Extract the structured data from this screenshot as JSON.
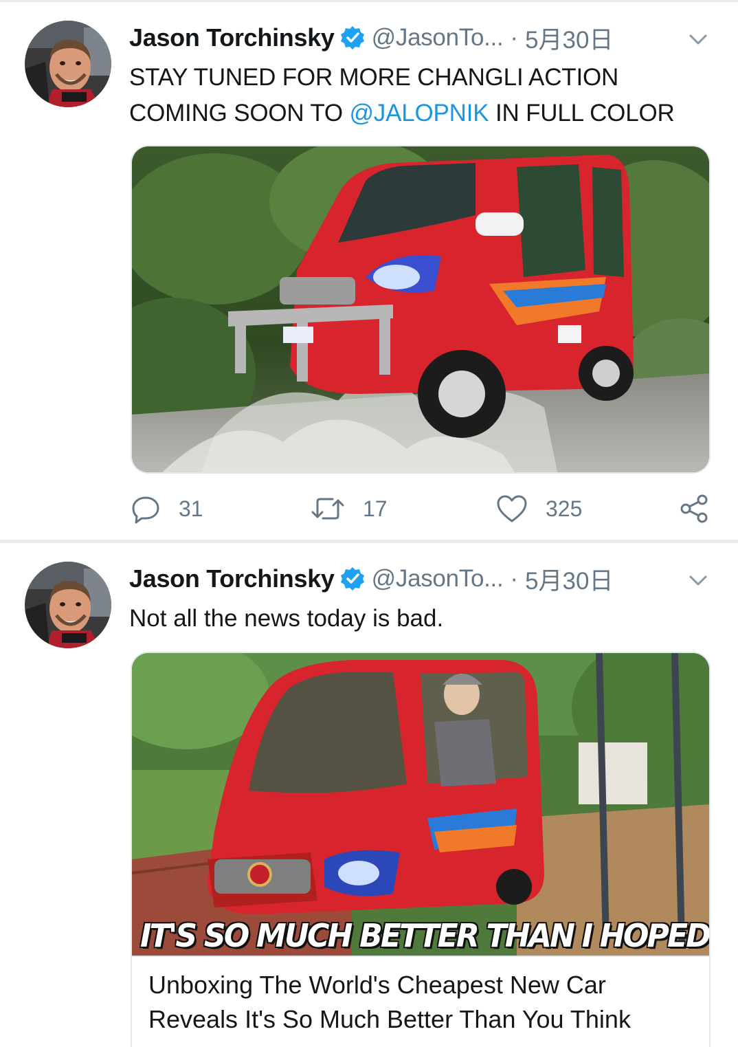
{
  "tweets": [
    {
      "author": {
        "display_name": "Jason Torchinsky",
        "handle": "@JasonTo...",
        "verified": true
      },
      "separator": "·",
      "date": "5月30日",
      "text_line1": "STAY TUNED FOR MORE CHANGLI ACTION",
      "text_line2_prefix": "COMING SOON TO ",
      "text_line2_mention": "@JALOPNIK",
      "text_line2_suffix": " IN FULL COLOR",
      "media": {
        "description_icon": "red-changli-car-splashing-through-water"
      },
      "stats": {
        "replies": "31",
        "retweets": "17",
        "likes": "325"
      }
    },
    {
      "author": {
        "display_name": "Jason Torchinsky",
        "handle": "@JasonTo...",
        "verified": true
      },
      "separator": "·",
      "date": "5月30日",
      "text": "Not all the news today is bad.",
      "card": {
        "banner_text": "IT'S SO MUCH BETTER THAN I HOPED",
        "title_line1": "Unboxing The World's Cheapest New Car",
        "title_line2": "Reveals It's So Much Better Than You Think"
      }
    }
  ],
  "colors": {
    "text_primary": "#14171a",
    "text_secondary": "#657786",
    "link": "#1b95e0",
    "verified": "#1da1f2",
    "divider": "#e6ecf0",
    "car_red": "#d8242c"
  },
  "icons": {
    "verified": "verified-badge-icon",
    "caret": "chevron-down-icon",
    "reply": "reply-bubble-icon",
    "retweet": "retweet-icon",
    "like": "heart-icon",
    "share": "share-icon"
  }
}
